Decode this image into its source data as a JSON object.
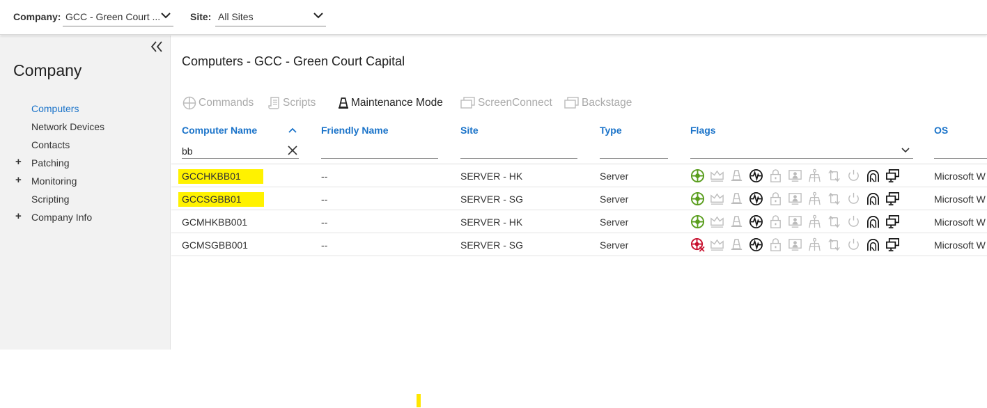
{
  "topbar": {
    "company_label": "Company:",
    "company_value": "GCC - Green Court ...",
    "site_label": "Site:",
    "site_value": "All Sites"
  },
  "sidebar": {
    "title": "Company",
    "items": [
      {
        "label": "Computers",
        "expandable": false,
        "active": true
      },
      {
        "label": "Network Devices",
        "expandable": false,
        "active": false
      },
      {
        "label": "Contacts",
        "expandable": false,
        "active": false
      },
      {
        "label": "Patching",
        "expandable": true,
        "active": false
      },
      {
        "label": "Monitoring",
        "expandable": true,
        "active": false
      },
      {
        "label": "Scripting",
        "expandable": false,
        "active": false
      },
      {
        "label": "Company Info",
        "expandable": true,
        "active": false
      }
    ]
  },
  "main": {
    "title": "Computers - GCC - Green Court Capital",
    "toolbar": {
      "commands": "Commands",
      "scripts": "Scripts",
      "maintenance": "Maintenance Mode",
      "screenconnect": "ScreenConnect",
      "backstage": "Backstage"
    },
    "columns": {
      "computer_name": "Computer Name",
      "friendly_name": "Friendly Name",
      "site": "Site",
      "type": "Type",
      "flags": "Flags",
      "os": "OS"
    },
    "filters": {
      "computer_name": "bb"
    },
    "rows": [
      {
        "name": "GCCHKBB01",
        "friendly": "--",
        "site": "SERVER - HK",
        "type": "Server",
        "os": "Microsoft W",
        "agent_status": "online",
        "highlighted": true
      },
      {
        "name": "GCCSGBB01",
        "friendly": "--",
        "site": "SERVER - SG",
        "type": "Server",
        "os": "Microsoft W",
        "agent_status": "online",
        "highlighted": true
      },
      {
        "name": "GCMHKBB001",
        "friendly": "--",
        "site": "SERVER - HK",
        "type": "Server",
        "os": "Microsoft W",
        "agent_status": "online",
        "highlighted": false
      },
      {
        "name": "GCMSGBB001",
        "friendly": "--",
        "site": "SERVER - SG",
        "type": "Server",
        "os": "Microsoft W",
        "agent_status": "offline",
        "highlighted": false
      }
    ],
    "flag_icons": [
      "agent-status-icon",
      "crown-icon",
      "maintenance-icon",
      "monitor-pulse-icon",
      "lock-icon",
      "presentation-icon",
      "network-tree-icon",
      "sync-icon",
      "power-icon",
      "remote-access-icon",
      "remote-desktop-icon"
    ]
  },
  "colors": {
    "accent": "#1a73c9",
    "highlight": "#fff200",
    "online": "#5a9e1e",
    "offline": "#c8102e",
    "disabled": "#bbbbbb"
  }
}
